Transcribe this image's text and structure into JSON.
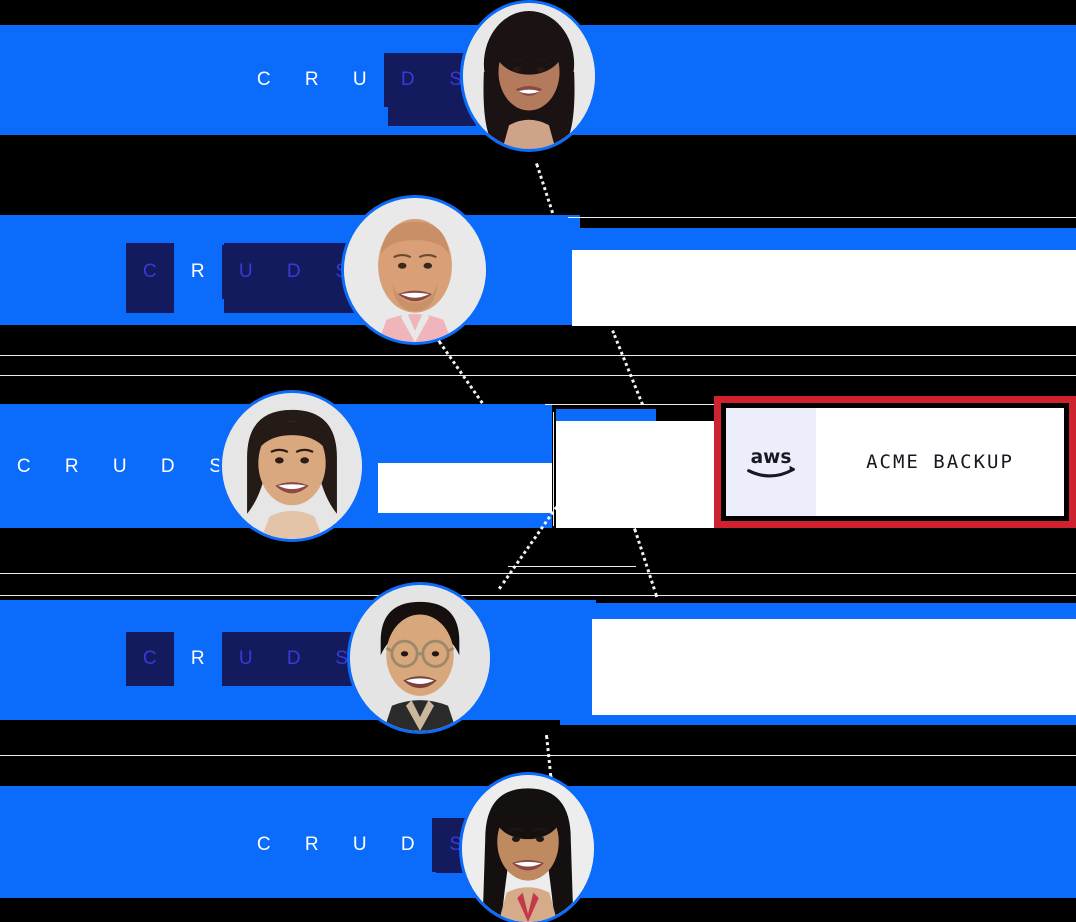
{
  "meta": {
    "background_color": "#000000",
    "accent_blue": "#0b6cfb",
    "highlight_navy": "#141a5e",
    "highlight_letter_color": "#3a39d8",
    "alert_red": "#d0212f",
    "panel_white": "#ffffff"
  },
  "permission_rows": [
    {
      "id": "row-1",
      "letters": [
        "C",
        "R",
        "U",
        "D",
        "S"
      ],
      "highlighted": [
        "D",
        "S"
      ],
      "avatar": {
        "name": "avatar-person-1",
        "alt": "smiling woman with long dark hair"
      }
    },
    {
      "id": "row-2",
      "letters": [
        "C",
        "R",
        "U",
        "D",
        "S"
      ],
      "highlighted": [
        "C",
        "U",
        "D",
        "S"
      ],
      "avatar": {
        "name": "avatar-person-2",
        "alt": "smiling bald man in pink shirt"
      }
    },
    {
      "id": "row-3",
      "letters": [
        "C",
        "R",
        "U",
        "D",
        "S"
      ],
      "highlighted": [],
      "avatar": {
        "name": "avatar-person-3",
        "alt": "smiling woman with shoulder-length dark hair"
      }
    },
    {
      "id": "row-4",
      "letters": [
        "C",
        "R",
        "U",
        "D",
        "S"
      ],
      "highlighted": [
        "C",
        "U",
        "D",
        "S"
      ],
      "avatar": {
        "name": "avatar-person-4",
        "alt": "smiling man with glasses"
      }
    },
    {
      "id": "row-5",
      "letters": [
        "C",
        "R",
        "U",
        "D",
        "S"
      ],
      "highlighted": [
        "S"
      ],
      "avatar": {
        "name": "avatar-person-5",
        "alt": "smiling young woman with long dark hair"
      }
    }
  ],
  "alert_card": {
    "logo_icon": "aws-logo",
    "logo_text": "aws",
    "title": "ACME BACKUP",
    "border_color": "#d0212f"
  },
  "letters_legend": {
    "C": "C",
    "R": "R",
    "U": "U",
    "D": "D",
    "S": "S"
  }
}
